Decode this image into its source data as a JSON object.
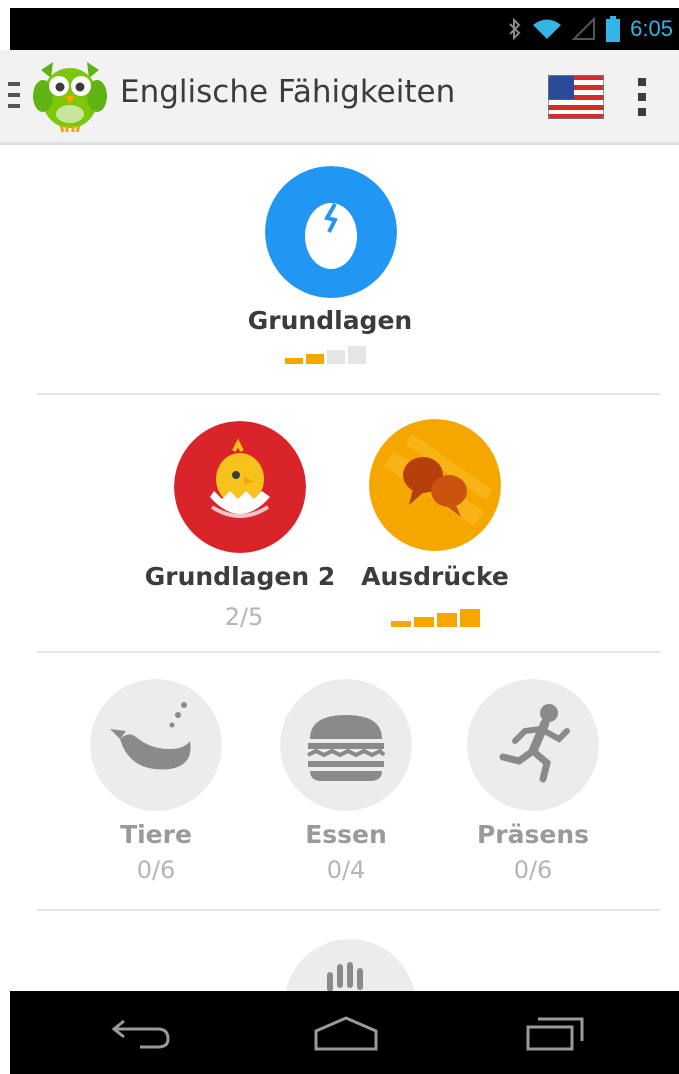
{
  "status_bar": {
    "time": "6:05",
    "icons": [
      "bluetooth-icon",
      "wifi-icon",
      "signal-icon",
      "battery-icon"
    ]
  },
  "app_bar": {
    "title": "Englische Fähigkeiten",
    "flag": "us-flag-icon"
  },
  "skills": {
    "grundlagen": {
      "name": "Grundlagen",
      "strength": 2,
      "color": "#2196f3"
    },
    "grundlagen2": {
      "name": "Grundlagen 2",
      "progress": "2/5",
      "color": "#d9252a"
    },
    "ausdruecke": {
      "name": "Ausdrücke",
      "strength": 4,
      "color": "#f5a700"
    },
    "tiere": {
      "name": "Tiere",
      "progress": "0/6"
    },
    "essen": {
      "name": "Essen",
      "progress": "0/4"
    },
    "praesens": {
      "name": "Präsens",
      "progress": "0/6"
    }
  },
  "colors": {
    "accent": "#f5a700",
    "locked_circle": "#ececec",
    "locked_icon": "#8a8a8a"
  },
  "nav_bar": {
    "icons": [
      "back-icon",
      "home-icon",
      "recent-apps-icon"
    ]
  }
}
